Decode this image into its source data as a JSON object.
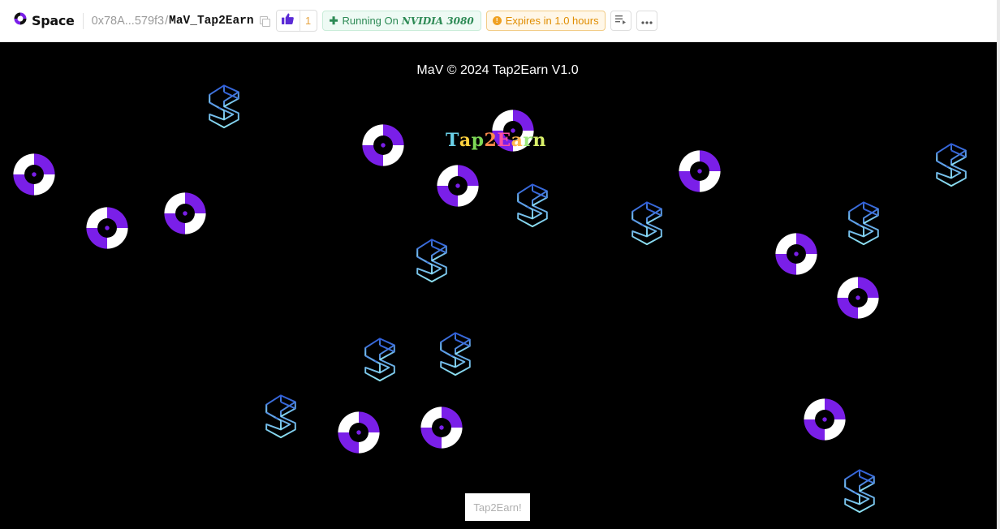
{
  "header": {
    "brand": "Space",
    "owner": "0x78A...579f3",
    "separator": "/",
    "repo": "MaV_Tap2Earn",
    "likes": "1",
    "running_label": "Running On",
    "gpu": "NVIDIA 3080",
    "expires_label": "Expires in 1.0 hours"
  },
  "colors": {
    "brand_purple": "#7a1fe8",
    "like_count": "#e6a23c",
    "running_green": "#2d8a55",
    "expires_orange": "#e08d00",
    "s_gradient_top": "#2f5dd8",
    "s_gradient_bottom": "#8fe3f2"
  },
  "app": {
    "footer": "MaV © 2024 Tap2Earn V1.0",
    "title_letters": [
      "T",
      "a",
      "p",
      "2",
      "E",
      "a",
      "r",
      "n"
    ],
    "title_colors": [
      "#6ad0e8",
      "#ffd23f",
      "#7ed957",
      "#ff8a4c",
      "#ff4fa0",
      "#ffb84d",
      "#9ce87a",
      "#d9f06a"
    ],
    "button_label": "Tap2Earn!"
  },
  "icons": {
    "brand": "space-logo-icon",
    "copy": "copy-icon",
    "like": "thumbs-up-icon",
    "running": "plus-icon",
    "expires": "warning-icon",
    "menu": "playlist-icon",
    "more": "ellipsis-icon",
    "coin": "spinning-coin-icon",
    "s_block": "s-block-icon"
  }
}
